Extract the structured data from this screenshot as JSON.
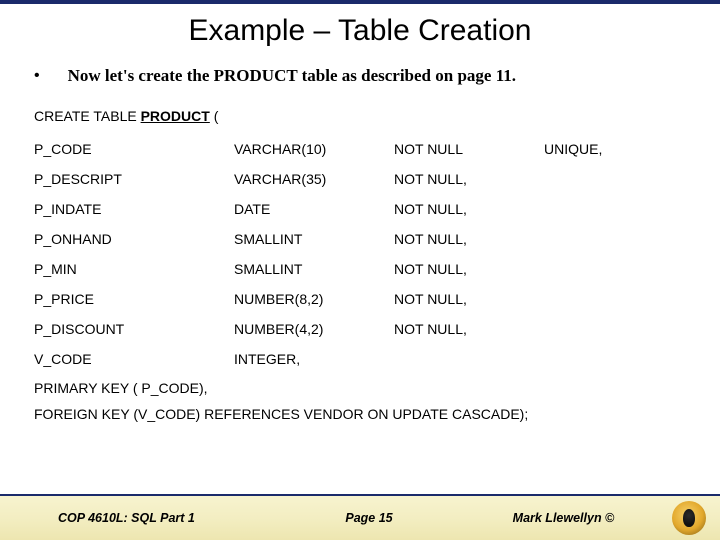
{
  "title": "Example – Table Creation",
  "bullet": "•",
  "intro": "Now let's create the PRODUCT table as described on page 11.",
  "create_prefix": "CREATE TABLE ",
  "create_kw": "PRODUCT",
  "create_suffix": " (",
  "columns": [
    {
      "name": "P_CODE",
      "type": "VARCHAR(10)",
      "null": "NOT NULL",
      "extra": "UNIQUE,"
    },
    {
      "name": "P_DESCRIPT",
      "type": "VARCHAR(35)",
      "null": "NOT NULL,",
      "extra": ""
    },
    {
      "name": "P_INDATE",
      "type": "DATE",
      "null": "NOT NULL,",
      "extra": ""
    },
    {
      "name": "P_ONHAND",
      "type": "SMALLINT",
      "null": "NOT NULL,",
      "extra": ""
    },
    {
      "name": "P_MIN",
      "type": "SMALLINT",
      "null": "NOT NULL,",
      "extra": ""
    },
    {
      "name": "P_PRICE",
      "type": "NUMBER(8,2)",
      "null": "NOT NULL,",
      "extra": ""
    },
    {
      "name": "P_DISCOUNT",
      "type": "NUMBER(4,2)",
      "null": "NOT NULL,",
      "extra": ""
    },
    {
      "name": "V_CODE",
      "type": "INTEGER,",
      "null": "",
      "extra": ""
    }
  ],
  "pk_line": "PRIMARY KEY ( P_CODE),",
  "fk_line": "FOREIGN KEY (V_CODE) REFERENCES VENDOR  ON UPDATE CASCADE);",
  "footer": {
    "left": "COP 4610L: SQL Part 1",
    "center": "Page 15",
    "right": "Mark Llewellyn ©"
  }
}
